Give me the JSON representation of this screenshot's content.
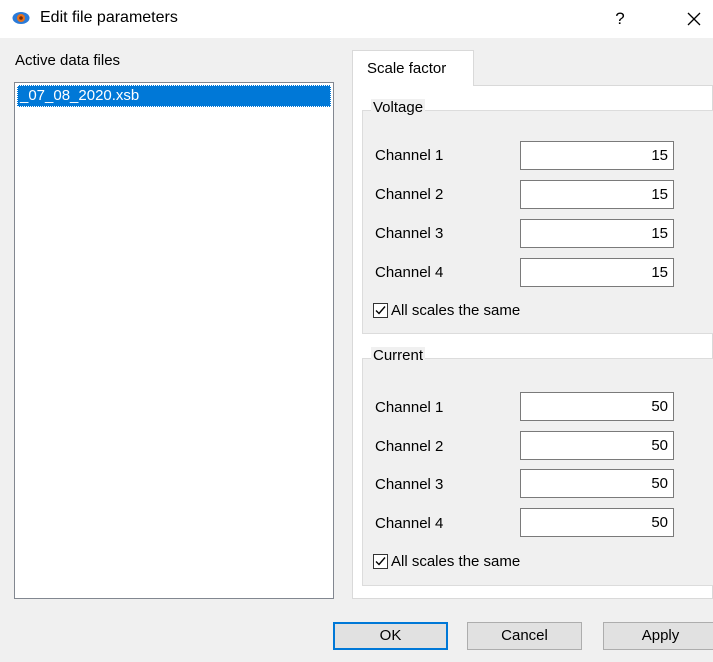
{
  "window": {
    "title": "Edit file parameters",
    "help_glyph": "?"
  },
  "files": {
    "label": "Active data files",
    "items": [
      "_07_08_2020.xsb"
    ]
  },
  "tabs": [
    {
      "label": "Scale factor"
    }
  ],
  "voltage": {
    "title": "Voltage",
    "channels": [
      {
        "label": "Channel 1",
        "value": "15"
      },
      {
        "label": "Channel 2",
        "value": "15"
      },
      {
        "label": "Channel 3",
        "value": "15"
      },
      {
        "label": "Channel 4",
        "value": "15"
      }
    ],
    "same_label": "All scales the same",
    "same_checked": true
  },
  "current": {
    "title": "Current",
    "channels": [
      {
        "label": "Channel 1",
        "value": "50"
      },
      {
        "label": "Channel 2",
        "value": "50"
      },
      {
        "label": "Channel 3",
        "value": "50"
      },
      {
        "label": "Channel 4",
        "value": "50"
      }
    ],
    "same_label": "All scales the same",
    "same_checked": true
  },
  "buttons": {
    "ok": "OK",
    "cancel": "Cancel",
    "apply": "Apply"
  },
  "icons": {
    "app": "eye-icon",
    "close": "close-icon",
    "check": "checkmark-icon"
  }
}
